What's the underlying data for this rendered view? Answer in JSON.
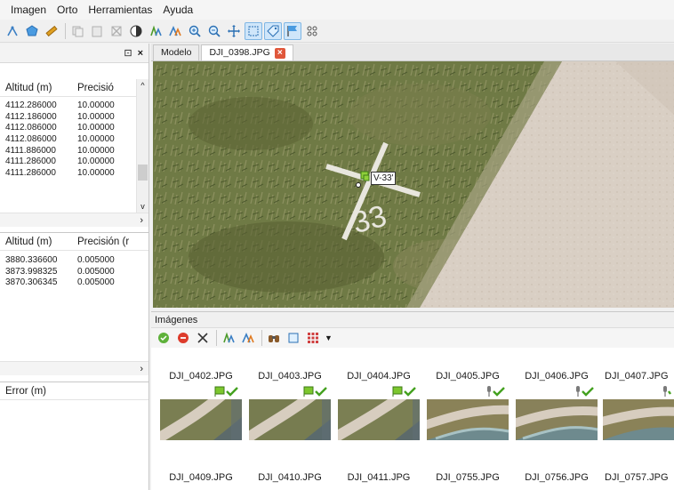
{
  "menu": {
    "items": [
      "Imagen",
      "Orto",
      "Herramientas",
      "Ayuda"
    ]
  },
  "left_panel": {
    "header_icons": [
      "pin-icon",
      "close-icon"
    ],
    "header_close": "×",
    "header_pin": "⊡",
    "table1": {
      "columns": [
        "Altitud (m)",
        "Precisió"
      ],
      "rows": [
        [
          "4112.286000",
          "10.00000"
        ],
        [
          "4112.186000",
          "10.00000"
        ],
        [
          "4112.086000",
          "10.00000"
        ],
        [
          "4112.086000",
          "10.00000"
        ],
        [
          "4111.886000",
          "10.00000"
        ],
        [
          "4111.286000",
          "10.00000"
        ],
        [
          "4111.286000",
          "10.00000"
        ]
      ],
      "scroll_arrow": "›"
    },
    "table2": {
      "columns": [
        "Altitud (m)",
        "Precisión (r"
      ],
      "rows": [
        [
          "3880.336600",
          "0.005000"
        ],
        [
          "3873.998325",
          "0.005000"
        ],
        [
          "3870.306345",
          "0.005000"
        ]
      ],
      "scroll_arrow": "›"
    },
    "table3": {
      "columns": [
        "Error (m)"
      ]
    }
  },
  "tabs": [
    {
      "label": "Modelo",
      "active": false
    },
    {
      "label": "DJI_0398.JPG",
      "active": true,
      "close": "×"
    }
  ],
  "map": {
    "gcp_label": "V-33'"
  },
  "images_panel": {
    "title": "Imágenes",
    "row1": [
      {
        "name": "DJI_0402.JPG",
        "icons": "flag-check"
      },
      {
        "name": "DJI_0403.JPG",
        "icons": "flag-check"
      },
      {
        "name": "DJI_0404.JPG",
        "icons": "flag-check"
      },
      {
        "name": "DJI_0405.JPG",
        "icons": "pin-check"
      },
      {
        "name": "DJI_0406.JPG",
        "icons": "pin-check"
      },
      {
        "name": "DJI_0407.JPG",
        "icons": "pin-check"
      }
    ],
    "row2": [
      {
        "name": "DJI_0409.JPG"
      },
      {
        "name": "DJI_0410.JPG"
      },
      {
        "name": "DJI_0411.JPG"
      },
      {
        "name": "DJI_0755.JPG"
      },
      {
        "name": "DJI_0756.JPG"
      },
      {
        "name": "DJI_0757.JPG"
      }
    ]
  },
  "colors": {
    "accent": "#3c8fd8",
    "close_red": "#e0573b",
    "flag_green": "#7cc72d",
    "check_green": "#43a11f"
  }
}
